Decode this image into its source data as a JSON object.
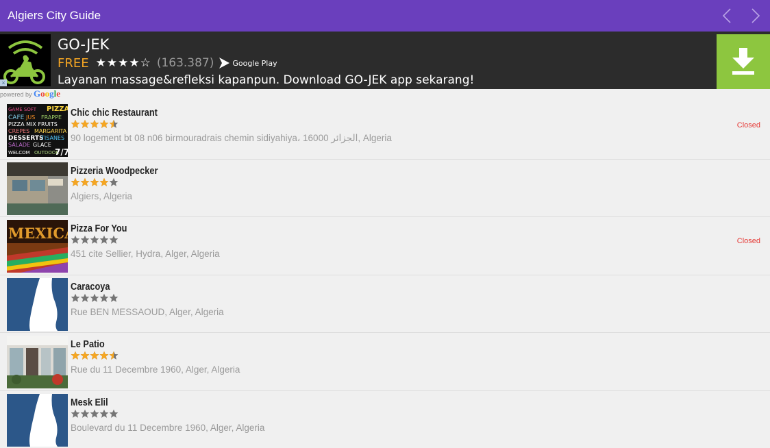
{
  "app": {
    "title": "Algiers City Guide"
  },
  "ad": {
    "app_name": "GO-JEK",
    "price": "FREE",
    "stars": "★★★★☆",
    "rating_count": "(163.387)",
    "store": "Google Play",
    "description": "Layanan massage&refleksi kapanpun. Download GO-JEK app sekarang!",
    "close": "×",
    "powered_prefix": "powered by",
    "powered_brand": "Google"
  },
  "colors": {
    "appbar": "#6a3fbd",
    "download": "#8dc63f",
    "star_on": "#f5a623",
    "star_off": "#757575",
    "closed": "#e53935"
  },
  "places": [
    {
      "name": "Chic chic Restaurant",
      "rating": 4.5,
      "address": "90 logement bt 08 n06 birmouradrais chemin sidiyahiya، 16000 الجزائر, Algeria",
      "status": "Closed",
      "thumb": "menu-board"
    },
    {
      "name": "Pizzeria Woodpecker",
      "rating": 4,
      "address": "Algiers, Algeria",
      "status": "",
      "thumb": "storefront"
    },
    {
      "name": "Pizza For You",
      "rating": 0,
      "address": "451 cite Sellier, Hydra, Alger, Algeria",
      "status": "Closed",
      "thumb": "mexican-sign"
    },
    {
      "name": "Caracoya",
      "rating": 0,
      "address": "Rue BEN MESSAOUD, Alger, Algeria",
      "status": "",
      "thumb": "map-placeholder"
    },
    {
      "name": "Le Patio",
      "rating": 4.5,
      "address": "Rue du 11 Decembre 1960, Alger, Algeria",
      "status": "",
      "thumb": "patio"
    },
    {
      "name": "Mesk Elil",
      "rating": 0,
      "address": "Boulevard du 11 Decembre 1960, Alger, Algeria",
      "status": "",
      "thumb": "map-placeholder"
    }
  ]
}
